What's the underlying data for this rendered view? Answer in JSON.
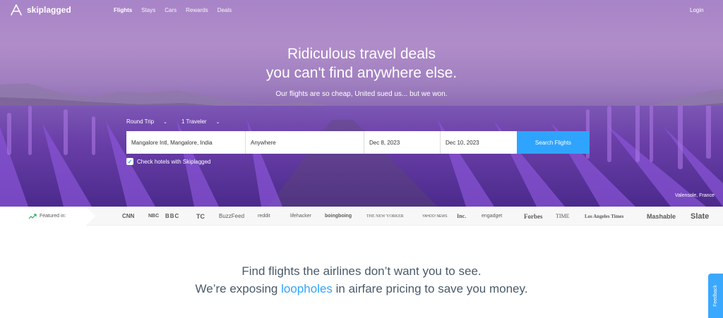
{
  "brand": {
    "name": "skiplagged"
  },
  "nav": {
    "links": [
      "Flights",
      "Stays",
      "Cars",
      "Rewards",
      "Deals"
    ],
    "login": "Login"
  },
  "hero": {
    "headline_1": "Ridiculous travel deals",
    "headline_2": "you can't find anywhere else.",
    "subline": "Our flights are so cheap, United sued us... but we won.",
    "trip_type": "Round Trip",
    "travelers": "1 Traveler",
    "photo_credit": "Valensole, France"
  },
  "search": {
    "from": "Mangalore Intl, Mangalore, India",
    "to_placeholder": "Anywhere",
    "depart": "Dec 8, 2023",
    "return": "Dec 10, 2023",
    "button": "Search Flights",
    "hotel_check_label": "Check hotels with Skiplagged",
    "hotel_checked": true
  },
  "featured": {
    "label": "Featured in:",
    "outlets": [
      "CNN",
      "NBC",
      "BBC",
      "TC",
      "BuzzFeed",
      "reddit",
      "lifehacker",
      "boingboing",
      "THE NEW YORKER",
      "YAHOO! NEWS",
      "Inc.",
      "engadget",
      "Forbes",
      "TIME",
      "Los Angeles Times",
      "Mashable",
      "Slate"
    ]
  },
  "tagline": {
    "line1": "Find flights the airlines don’t want you to see.",
    "line2_before": "We’re exposing ",
    "line2_link": "loopholes",
    "line2_after": " in airfare pricing to save you money."
  },
  "feedback": {
    "label": "Feedback"
  },
  "colors": {
    "accent": "#2fa4ff",
    "hero_purple": "#5a3596"
  }
}
